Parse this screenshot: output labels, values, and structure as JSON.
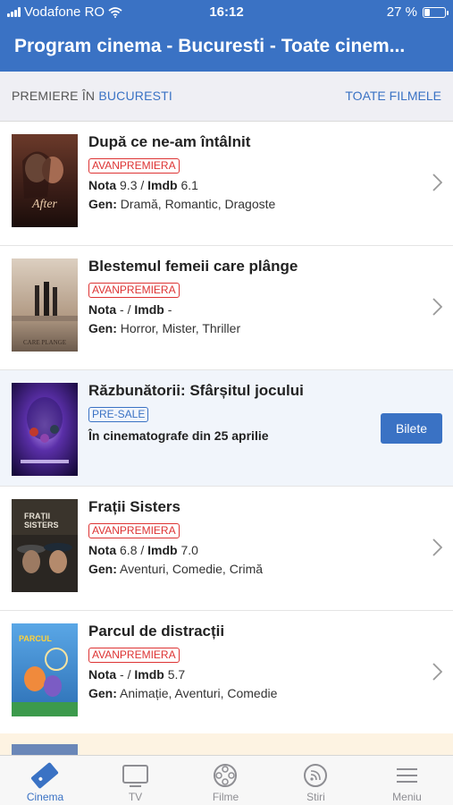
{
  "status": {
    "carrier": "Vodafone RO",
    "time": "16:12",
    "battery": "27 %",
    "battery_level": 0.27
  },
  "header": {
    "title": "Program cinema - Bucuresti - Toate cinem..."
  },
  "subheader": {
    "prefix": "PREMIERE ÎN",
    "city": "BUCURESTI",
    "all_films": "TOATE FILMELE"
  },
  "movies": [
    {
      "title": "După ce ne-am întâlnit",
      "badge": "AVANPREMIERA",
      "nota_label": "Nota",
      "nota": "9.3",
      "imdb_label": "Imdb",
      "imdb": "6.1",
      "gen_label": "Gen:",
      "gen": "Dramă, Romantic, Dragoste"
    },
    {
      "title": "Blestemul femeii care plânge",
      "badge": "AVANPREMIERA",
      "nota_label": "Nota",
      "nota": "-",
      "imdb_label": "Imdb",
      "imdb": "-",
      "gen_label": "Gen:",
      "gen": "Horror, Mister, Thriller"
    },
    {
      "title": "Răzbunătorii: Sfârșitul jocului",
      "badge": "PRE-SALE",
      "release": "În cinematografe din 25 aprilie",
      "button": "Bilete"
    },
    {
      "title": "Frații Sisters",
      "badge": "AVANPREMIERA",
      "nota_label": "Nota",
      "nota": "6.8",
      "imdb_label": "Imdb",
      "imdb": "7.0",
      "gen_label": "Gen:",
      "gen": "Aventuri, Comedie, Crimă"
    },
    {
      "title": "Parcul de distracții",
      "badge": "AVANPREMIERA",
      "nota_label": "Nota",
      "nota": "-",
      "imdb_label": "Imdb",
      "imdb": "5.7",
      "gen_label": "Gen:",
      "gen": "Animație, Aventuri, Comedie"
    }
  ],
  "tabs": [
    {
      "label": "Cinema",
      "icon": "ticket-icon",
      "active": true
    },
    {
      "label": "TV",
      "icon": "tv-icon",
      "active": false
    },
    {
      "label": "Filme",
      "icon": "film-reel-icon",
      "active": false
    },
    {
      "label": "Stiri",
      "icon": "rss-icon",
      "active": false
    },
    {
      "label": "Meniu",
      "icon": "menu-icon",
      "active": false
    }
  ],
  "colors": {
    "accent": "#3a72c4",
    "badge_red": "#d33333",
    "highlight_row": "#f1f5fb"
  }
}
